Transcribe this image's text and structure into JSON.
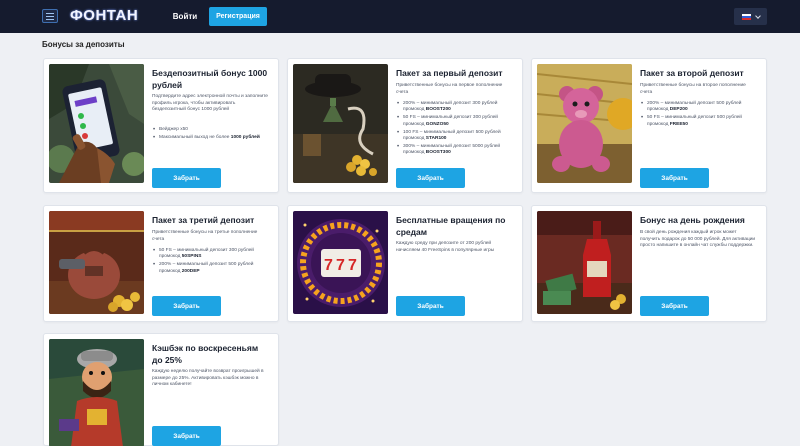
{
  "header": {
    "logo": "ФОНТАН",
    "login_label": "Войти",
    "register_label": "Регистрация"
  },
  "page_title": "Бонусы за депозиты",
  "cards": [
    {
      "title": "Бездепозитный бонус 1000 рублей",
      "desc": "Подтвердите адрес электронной почты и заполните профиль игрока, чтобы активировать бездепозитный бонус 1000 рублей",
      "bullets": [
        {
          "text": "Вейджер x50",
          "bold": ""
        },
        {
          "text": "Максимальный выход не более ",
          "bold": "1000 рублей"
        }
      ],
      "button": "Забрать",
      "icon": "phone-hand-image"
    },
    {
      "title": "Пакет за первый депозит",
      "desc": "Приветственные бонусы на первое пополнение счета",
      "bullets": [
        {
          "text": "200% – минимальный депозит 300 рублей промокод ",
          "bold": "BOOST200"
        },
        {
          "text": "50 FS – минимальный депозит 300 рублей промокод ",
          "bold": "GONZO50"
        },
        {
          "text": "100 FS – минимальный депозит 500 рублей промокод ",
          "bold": "STAR100"
        },
        {
          "text": "300% – минимальный депозит 5000 рублей промокод ",
          "bold": "BOOST300"
        }
      ],
      "button": "Забрать",
      "icon": "treasure-table-image"
    },
    {
      "title": "Пакет за второй депозит",
      "desc": "Приветственные бонусы на второе пополнение счета",
      "bullets": [
        {
          "text": "200% – минимальный депозит 500 рублей промокод ",
          "bold": "DEP200"
        },
        {
          "text": "50 FS – минимальный депозит 500 рублей промокод ",
          "bold": "FREE50"
        }
      ],
      "button": "Забрать",
      "icon": "pink-bear-image"
    },
    {
      "title": "Пакет за третий депозит",
      "desc": "Приветственные бонусы на третье пополнение счета",
      "bullets": [
        {
          "text": "50 FS – минимальный депозит 300 рублей промокод ",
          "bold": "50SPINS"
        },
        {
          "text": "200% – минимальный депозит 500 рублей промокод ",
          "bold": "200DEP"
        }
      ],
      "button": "Забрать",
      "icon": "money-bag-image"
    },
    {
      "title": "Бесплатные вращения по средам",
      "desc": "Каждую среду при депозите от 200 рублей начисляем 40 FreeSpins в популярные игры",
      "bullets": [],
      "button": "Забрать",
      "icon": "slot-777-image"
    },
    {
      "title": "Бонус на день рождения",
      "desc": "В свой день рождения каждый игрок может получить подарок до 50 000 рублей. Для активации просто напишите в онлайн чат службы поддержки.",
      "bullets": [],
      "button": "Забрать",
      "icon": "wine-bottle-image"
    },
    {
      "title": "Кэшбэк по воскресеньям до 25%",
      "desc": "Каждую неделю получайте возврат проигрышей в размере до 25%. Активировать кэшбэк можно в личном кабинете!",
      "bullets": [],
      "button": "Забрать",
      "icon": "gonzo-character-image"
    }
  ],
  "colors": {
    "header_bg": "#151b2e",
    "accent": "#1ea4e3",
    "page_bg": "#eef0f4"
  }
}
